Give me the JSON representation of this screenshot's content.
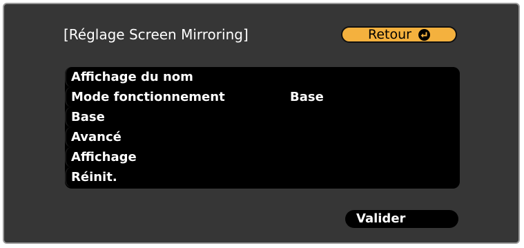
{
  "dialog": {
    "title": "[Réglage Screen Mirroring]",
    "back_label": "Retour",
    "back_icon": "enter-icon"
  },
  "menu": {
    "items": [
      {
        "label": "Affichage du nom",
        "value": ""
      },
      {
        "label": "Mode fonctionnement",
        "value": "Base"
      },
      {
        "label": "Base",
        "value": ""
      },
      {
        "label": "Avancé",
        "value": ""
      },
      {
        "label": "Affichage",
        "value": ""
      },
      {
        "label": "Réinit.",
        "value": ""
      }
    ]
  },
  "footer": {
    "validate_label": "Valider"
  },
  "colors": {
    "background": "#363636",
    "accent": "#f4b13e",
    "menu_bg": "#000000",
    "text": "#ffffff"
  }
}
